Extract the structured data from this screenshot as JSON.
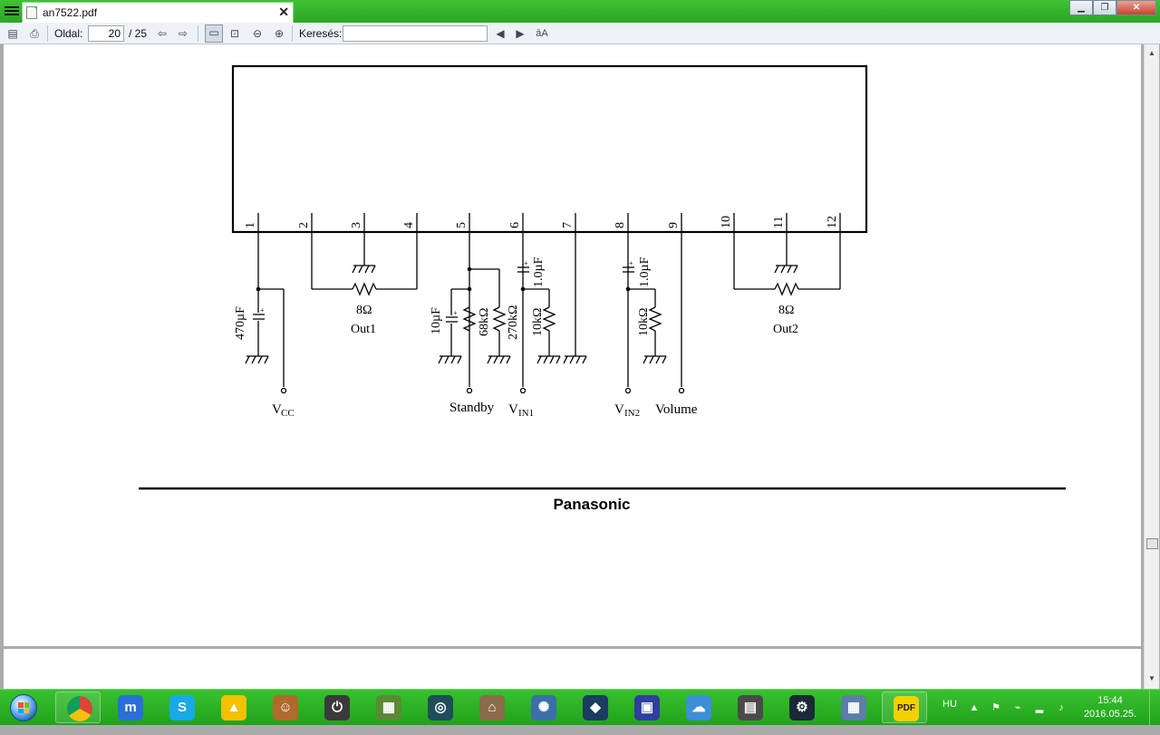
{
  "window": {
    "tab_title": "an7522.pdf",
    "close_glyph": "✕",
    "buttons": {
      "minimize": "▁",
      "maximize": "❐",
      "close": "✕"
    }
  },
  "toolbar": {
    "page_label": "Oldal:",
    "page_current": "20",
    "page_total": "/ 25",
    "search_label": "Keresés:",
    "search_value": "",
    "icons": [
      "open-icon",
      "print-icon",
      "prev-page-icon",
      "next-page-icon",
      "fit-page-icon",
      "fit-width-icon",
      "zoom-out-icon",
      "zoom-in-icon",
      "find-prev-icon",
      "find-next-icon",
      "match-case-icon"
    ],
    "match_case_glyph": "āA"
  },
  "schematic": {
    "pins": [
      "1",
      "2",
      "3",
      "4",
      "5",
      "6",
      "7",
      "8",
      "9",
      "10",
      "11",
      "12"
    ],
    "labels": {
      "c470": "470µF",
      "vcc_main": "V",
      "vcc_sub": "CC",
      "r_out1": "8Ω",
      "out1": "Out1",
      "c10": "10µF",
      "r68": "68kΩ",
      "r270": "270kΩ",
      "r10a": "10kΩ",
      "c1a": "1.0µF",
      "standby": "Standby",
      "vin1_main": "V",
      "vin1_sub": "IN1",
      "c1b": "1.0µF",
      "r10b": "10kΩ",
      "vin2_main": "V",
      "vin2_sub": "IN2",
      "volume": "Volume",
      "r_out2": "8Ω",
      "out2": "Out2"
    }
  },
  "footer": {
    "brand": "Panasonic"
  },
  "taskbar": {
    "apps": [
      {
        "name": "chrome",
        "glyph": "",
        "color": "#db4437"
      },
      {
        "name": "maxthon",
        "glyph": "m",
        "color": "#2a6fd6"
      },
      {
        "name": "skype",
        "glyph": "S",
        "color": "#18a9e8"
      },
      {
        "name": "archicad",
        "glyph": "▲",
        "color": "#f2c200"
      },
      {
        "name": "game-avatar",
        "glyph": "☺",
        "color": "#b06a2c"
      },
      {
        "name": "power-app",
        "glyph": "⏻",
        "color": "#3a3a3a"
      },
      {
        "name": "minecraft",
        "glyph": "▦",
        "color": "#5b8a35"
      },
      {
        "name": "league",
        "glyph": "◎",
        "color": "#1d4e5a"
      },
      {
        "name": "house-app",
        "glyph": "⌂",
        "color": "#8a6b4a"
      },
      {
        "name": "hearthstone",
        "glyph": "✺",
        "color": "#3b6fa8"
      },
      {
        "name": "nvidia-app",
        "glyph": "◆",
        "color": "#1a3d60"
      },
      {
        "name": "save-app",
        "glyph": "▣",
        "color": "#2f3f9e"
      },
      {
        "name": "cloud-app",
        "glyph": "☁",
        "color": "#3d8fd6"
      },
      {
        "name": "network-app",
        "glyph": "▤",
        "color": "#4a4a4a"
      },
      {
        "name": "steam",
        "glyph": "⚙",
        "color": "#1b2838"
      },
      {
        "name": "calculator",
        "glyph": "▦",
        "color": "#5d7ea8"
      },
      {
        "name": "pdf-viewer",
        "glyph": "PDF",
        "color": "#f4d000"
      }
    ],
    "lang": "HU",
    "time": "15:44",
    "date": "2016.05.25."
  }
}
